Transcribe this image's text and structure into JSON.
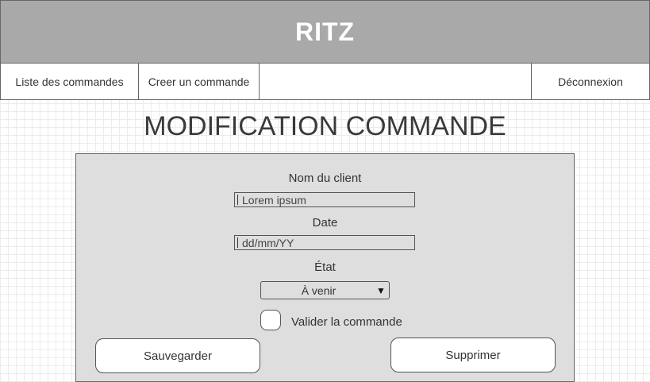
{
  "header": {
    "title": "RITZ"
  },
  "nav": {
    "list_orders": "Liste des commandes",
    "create_order": "Creer un commande",
    "logout": "Déconnexion"
  },
  "page": {
    "title": "MODIFICATION COMMANDE"
  },
  "form": {
    "client_label": "Nom du client",
    "client_value": "Lorem ipsum",
    "date_label": "Date",
    "date_value": "dd/mm/YY",
    "state_label": "État",
    "state_value": "À venir",
    "state_arrow": "▼",
    "validate_label": "Valider la commande",
    "save_button": "Sauvegarder",
    "delete_button": "Supprimer"
  }
}
